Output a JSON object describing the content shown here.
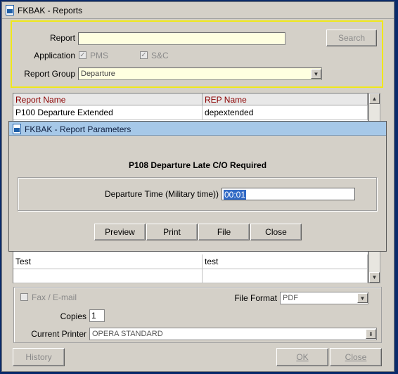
{
  "window": {
    "title": "FKBAK - Reports"
  },
  "search": {
    "report_label": "Report",
    "report_value": "",
    "search_button": "Search",
    "application_label": "Application",
    "app_pms": "PMS",
    "app_sc": "S&C",
    "report_group_label": "Report Group",
    "report_group_value": "Departure"
  },
  "table": {
    "columns": [
      "Report Name",
      "REP Name"
    ],
    "rows": [
      [
        "P100 Departure Extended",
        "depextended"
      ],
      [
        "Test",
        "test"
      ],
      [
        "",
        ""
      ]
    ]
  },
  "options": {
    "fax_email": "Fax / E-mail",
    "file_format_label": "File Format",
    "file_format_value": "PDF",
    "copies_label": "Copies",
    "copies_value": "1",
    "printer_label": "Current Printer",
    "printer_value": "OPERA STANDARD"
  },
  "footer": {
    "history": "History",
    "ok": "OK",
    "close": "Close"
  },
  "dialog": {
    "title": "FKBAK - Report Parameters",
    "heading": "P108 Departure Late C/O Required",
    "param_label": "Departure Time (Military time))",
    "param_value": "00:01",
    "preview": "Preview",
    "print": "Print",
    "file": "File",
    "close": "Close"
  },
  "colors": {
    "highlight_border": "#f0e81a",
    "header_text": "#8b0000",
    "selection": "#316ac5",
    "dialog_title": "#a6c8e8"
  }
}
